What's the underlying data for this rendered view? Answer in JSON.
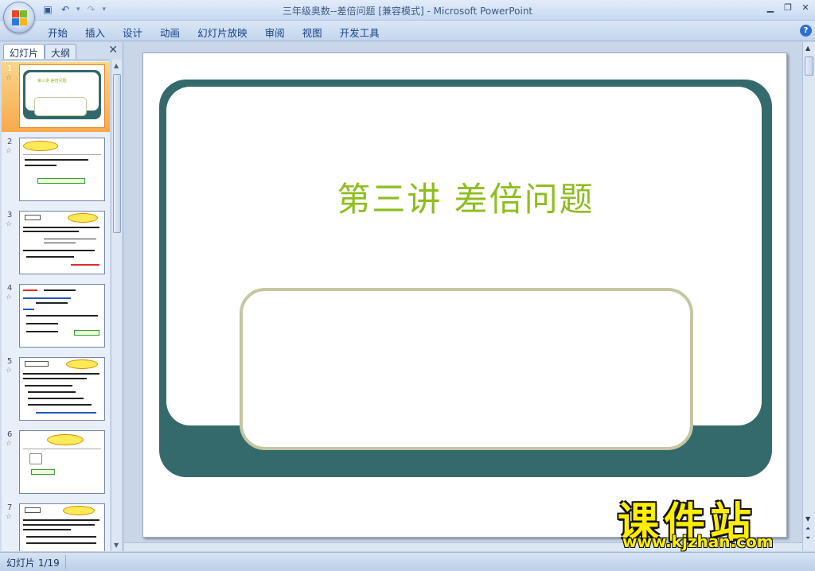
{
  "window": {
    "title": "三年级奥数--差倍问题 [兼容模式] - Microsoft PowerPoint"
  },
  "quick_access": {
    "icons": [
      "save-icon",
      "undo-icon",
      "redo-icon",
      "customize-icon"
    ]
  },
  "ribbon": {
    "tabs": [
      "开始",
      "插入",
      "设计",
      "动画",
      "幻灯片放映",
      "审阅",
      "视图",
      "开发工具"
    ]
  },
  "left_pane": {
    "tab_slides": "幻灯片",
    "tab_outline": "大纲",
    "close_glyph": "✕",
    "thumbnails": [
      {
        "number": "1",
        "title": "第三讲 差倍问题",
        "selected": true
      },
      {
        "number": "2",
        "selected": false
      },
      {
        "number": "3",
        "selected": false
      },
      {
        "number": "4",
        "selected": false
      },
      {
        "number": "5",
        "selected": false
      },
      {
        "number": "6",
        "selected": false
      },
      {
        "number": "7",
        "selected": false
      }
    ],
    "star_glyph": "☆"
  },
  "slide": {
    "title": "第三讲 差倍问题",
    "subtitle": ""
  },
  "status_bar": {
    "slide_indicator": "幻灯片 1/19"
  },
  "watermark": {
    "name": "课件站",
    "url": "www.kjzhan.com"
  },
  "colors": {
    "title_green": "#8ebd1e",
    "frame_teal": "#346a6b",
    "subtitle_border": "#c5c6a3"
  }
}
